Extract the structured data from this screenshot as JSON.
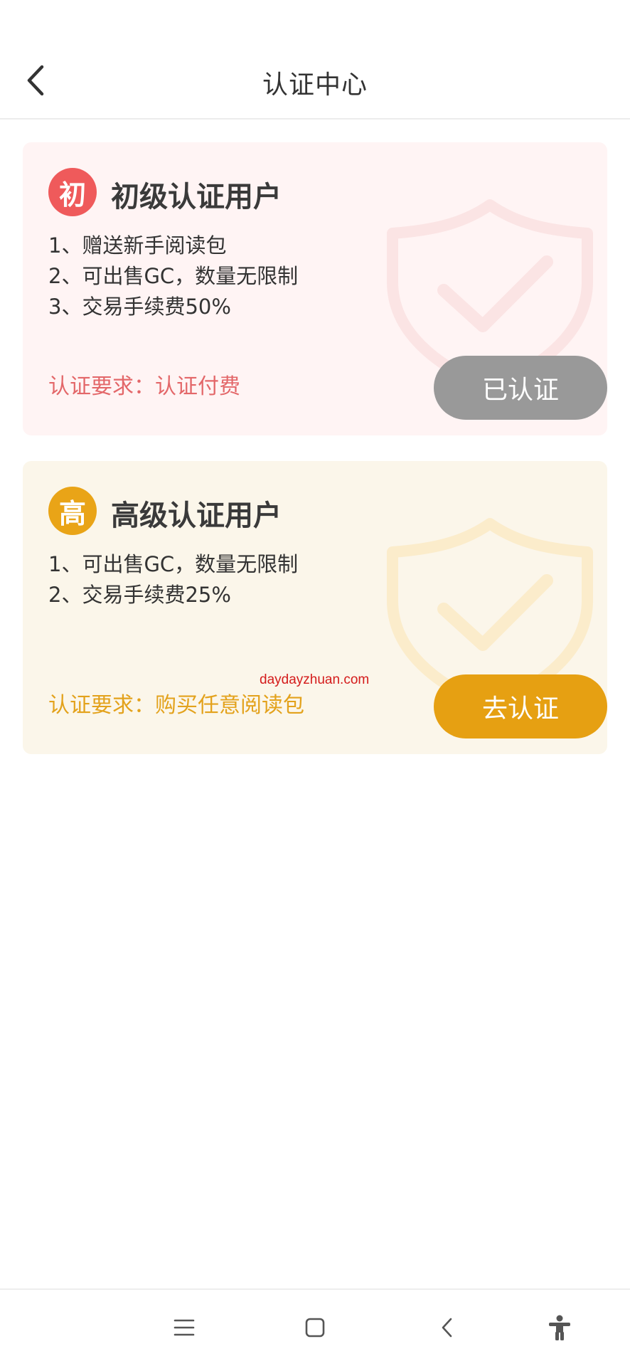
{
  "header": {
    "title": "认证中心",
    "back_icon": "chevron-left-icon"
  },
  "cards": [
    {
      "badge": "初",
      "title": "初级认证用户",
      "benefits": [
        "1、赠送新手阅读包",
        "2、可出售GC，数量无限制",
        "3、交易手续费50%"
      ],
      "requirement": "认证要求：认证付费",
      "action_label": "已认证",
      "accent_color": "#ef5a5b",
      "background_color": "#fff4f4",
      "button_color": "#999999",
      "watermark_icon": "shield-check-icon"
    },
    {
      "badge": "高",
      "title": "高级认证用户",
      "benefits": [
        "1、可出售GC，数量无限制",
        "2、交易手续费25%"
      ],
      "requirement": "认证要求：购买任意阅读包",
      "action_label": "去认证",
      "accent_color": "#e9a417",
      "background_color": "#fbf6ea",
      "button_color": "#e6a012",
      "watermark_icon": "shield-check-icon"
    }
  ],
  "watermark_text": "daydayzhuan.com",
  "navbar": {
    "icons": [
      "menu-icon",
      "home-square-icon",
      "back-triangle-icon",
      "accessibility-icon"
    ]
  }
}
